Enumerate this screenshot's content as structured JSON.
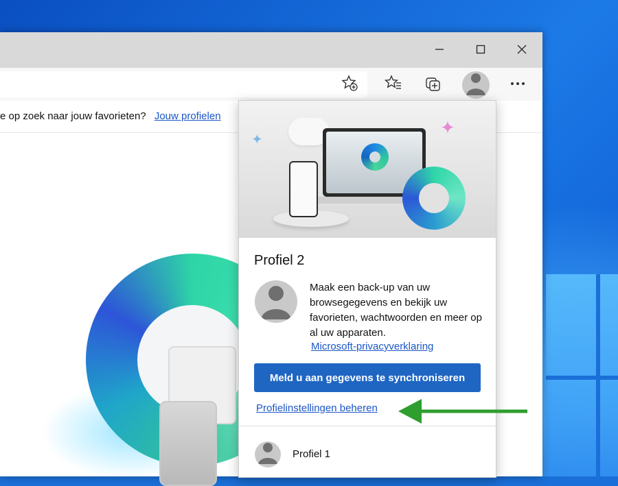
{
  "favorites_bar": {
    "prompt_text": "e op zoek naar jouw favorieten?",
    "link_text": "Jouw profielen"
  },
  "flyout": {
    "profile_title": "Profiel 2",
    "description": "Maak een back-up van uw browsegegevens en bekijk uw favorieten, wachtwoorden en meer op al uw apparaten.",
    "privacy_link": "Microsoft-privacyverklaring",
    "signin_button": "Meld u aan gegevens te synchroniseren",
    "manage_link": "Profielinstellingen beheren",
    "other_profiles": [
      {
        "name": "Profiel 1"
      }
    ]
  },
  "colors": {
    "accent": "#1f66c3",
    "link": "#1a56c6",
    "annotation_arrow": "#2e9e2e"
  },
  "icons": {
    "titlebar": [
      "minimize-icon",
      "maximize-icon",
      "close-icon"
    ],
    "toolbar": [
      "add-favorite-icon",
      "favorites-icon",
      "collections-icon",
      "profile-icon",
      "more-icon"
    ]
  }
}
